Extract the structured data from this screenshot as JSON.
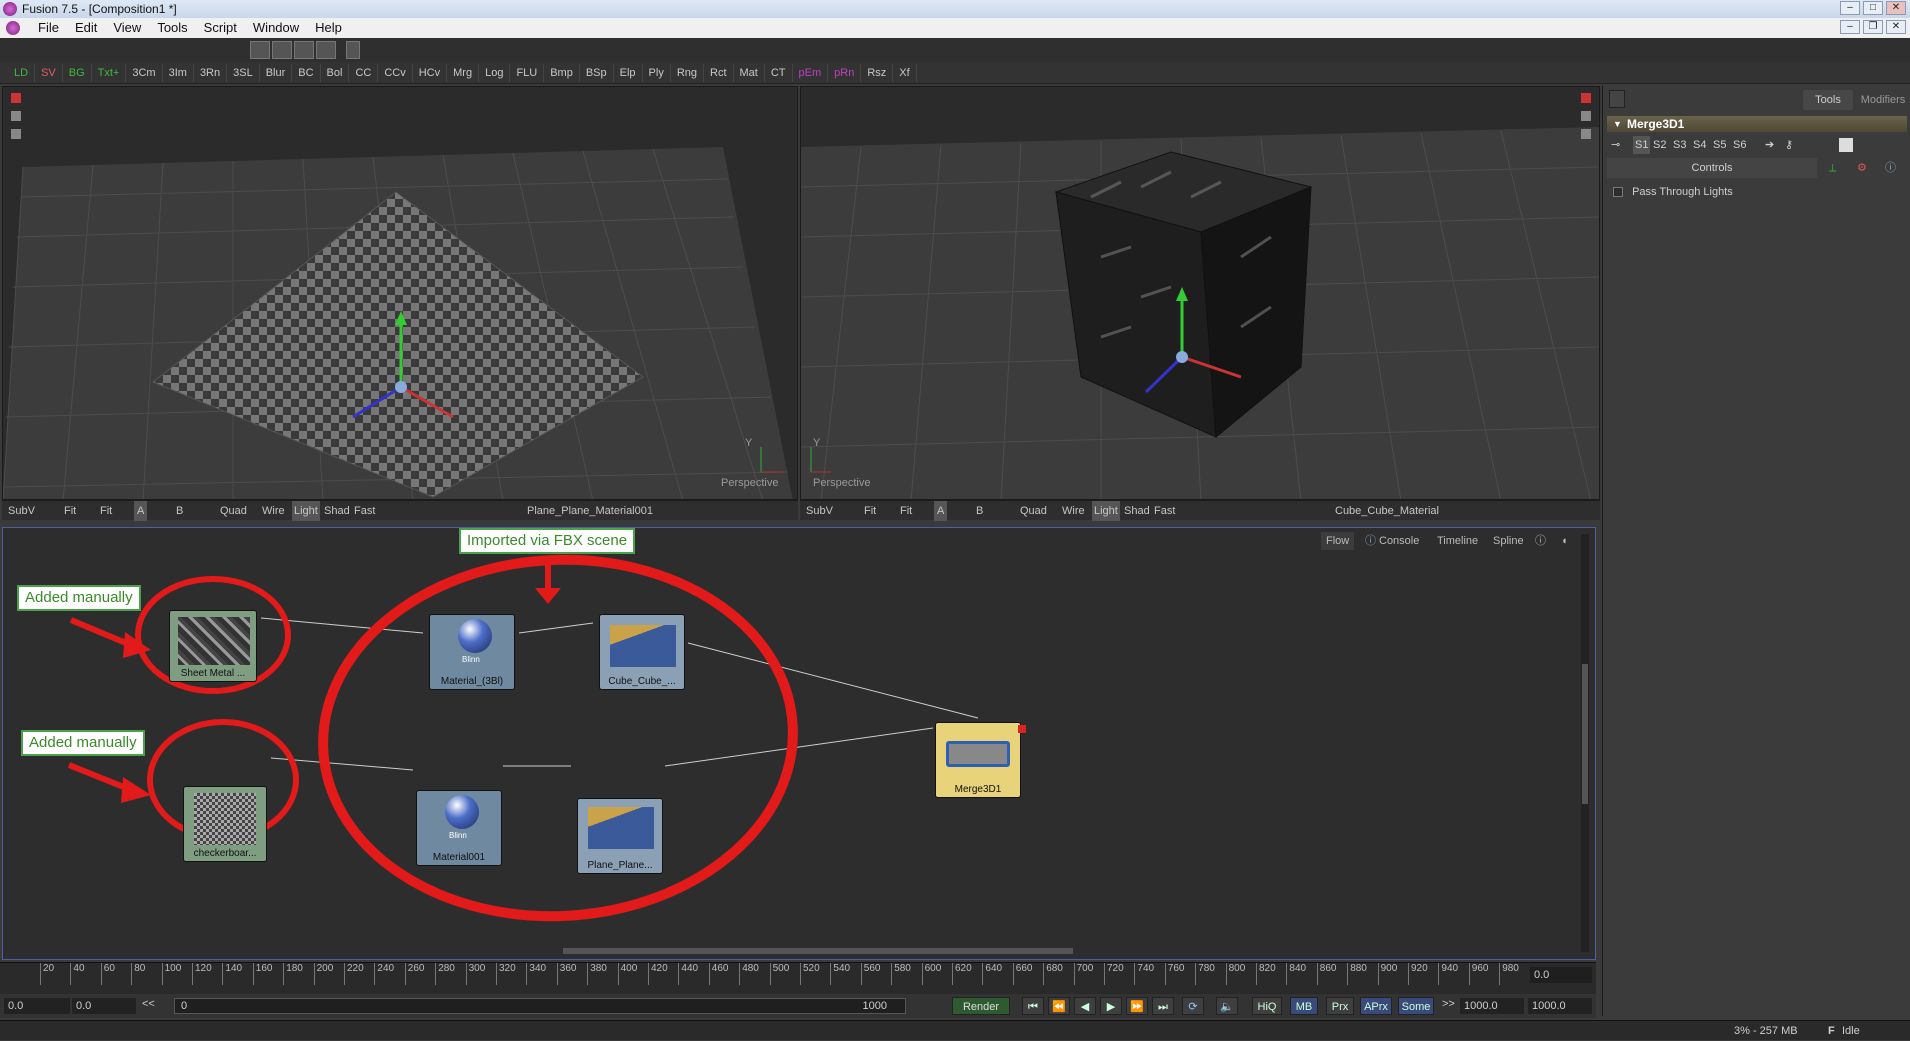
{
  "window": {
    "title": "Fusion 7.5 - [Composition1 *]"
  },
  "menu": [
    "File",
    "Edit",
    "View",
    "Tools",
    "Script",
    "Window",
    "Help"
  ],
  "toolbar": [
    "LD",
    "SV",
    "BG",
    "Txt+",
    "3Cm",
    "3Im",
    "3Rn",
    "3SL",
    "Blur",
    "BC",
    "Bol",
    "CC",
    "CCv",
    "HCv",
    "Mrg",
    "Log",
    "FLU",
    "Bmp",
    "BSp",
    "Elp",
    "Ply",
    "Rng",
    "Rct",
    "Mat",
    "CT",
    "pEm",
    "pRn",
    "Rsz",
    "Xf"
  ],
  "toolbar_colors": {
    "LD": "#3fb83f",
    "SV": "#e06060",
    "BG": "#3fb83f",
    "Txt+": "#3fb83f",
    "pEm": "#c040c0",
    "pRn": "#c040c0"
  },
  "viewer_left": {
    "name": "Plane_Plane_Material001",
    "perspective": "Perspective",
    "controls": [
      "SubV",
      "Fit",
      "Fit",
      "A",
      "B",
      "B",
      "Quad",
      "Wire",
      "Light",
      "Shad",
      "Fast"
    ]
  },
  "viewer_right": {
    "name": "Cube_Cube_Material",
    "perspective": "Perspective",
    "controls": [
      "SubV",
      "Fit",
      "Fit",
      "A",
      "B",
      "B",
      "Quad",
      "Wire",
      "Light",
      "Shad",
      "Fast"
    ]
  },
  "axis_label": "Y",
  "panel": {
    "tabs": [
      "Tools",
      "Modifiers"
    ],
    "tool_name": "Merge3D1",
    "scenes": [
      "S1",
      "S2",
      "S3",
      "S4",
      "S5",
      "S6"
    ],
    "controls_tab": "Controls",
    "option": "Pass Through Lights"
  },
  "flow": {
    "tabs": [
      "Flow",
      "Console",
      "Timeline",
      "Spline"
    ],
    "callouts": {
      "fbx": "Imported via FBX scene",
      "manual1": "Added manually",
      "manual2": "Added manually"
    },
    "nodes": {
      "sheet": "Sheet Metal ...",
      "checker": "checkerboar...",
      "mat3bl": "Material_(3Bl)",
      "mat001": "Material001",
      "blinn1": "Blinn",
      "blinn2": "Blinn",
      "cube": "Cube_Cube_...",
      "plane": "Plane_Plane...",
      "merge": "Merge3D1"
    }
  },
  "timeline": {
    "ticks": [
      "20",
      "40",
      "60",
      "80",
      "100",
      "120",
      "140",
      "160",
      "180",
      "200",
      "220",
      "240",
      "260",
      "280",
      "300",
      "320",
      "340",
      "360",
      "380",
      "400",
      "420",
      "440",
      "460",
      "480",
      "500",
      "520",
      "540",
      "560",
      "580",
      "600",
      "620",
      "640",
      "660",
      "680",
      "700",
      "720",
      "740",
      "760",
      "780",
      "800",
      "820",
      "840",
      "860",
      "880",
      "900",
      "920",
      "940",
      "960",
      "980"
    ],
    "current": "0.0",
    "start": "0.0",
    "render_start": "0.0",
    "range_start": "0",
    "range_end": "1000",
    "render_label": "Render",
    "buttons": [
      "HiQ",
      "MB",
      "Prx",
      "APrx",
      "Some"
    ],
    "end": "1000.0",
    "render_end": "1000.0",
    "prev": "<<",
    "next": ">>"
  },
  "status": {
    "memory": "3% - 257 MB",
    "state": "Idle"
  }
}
